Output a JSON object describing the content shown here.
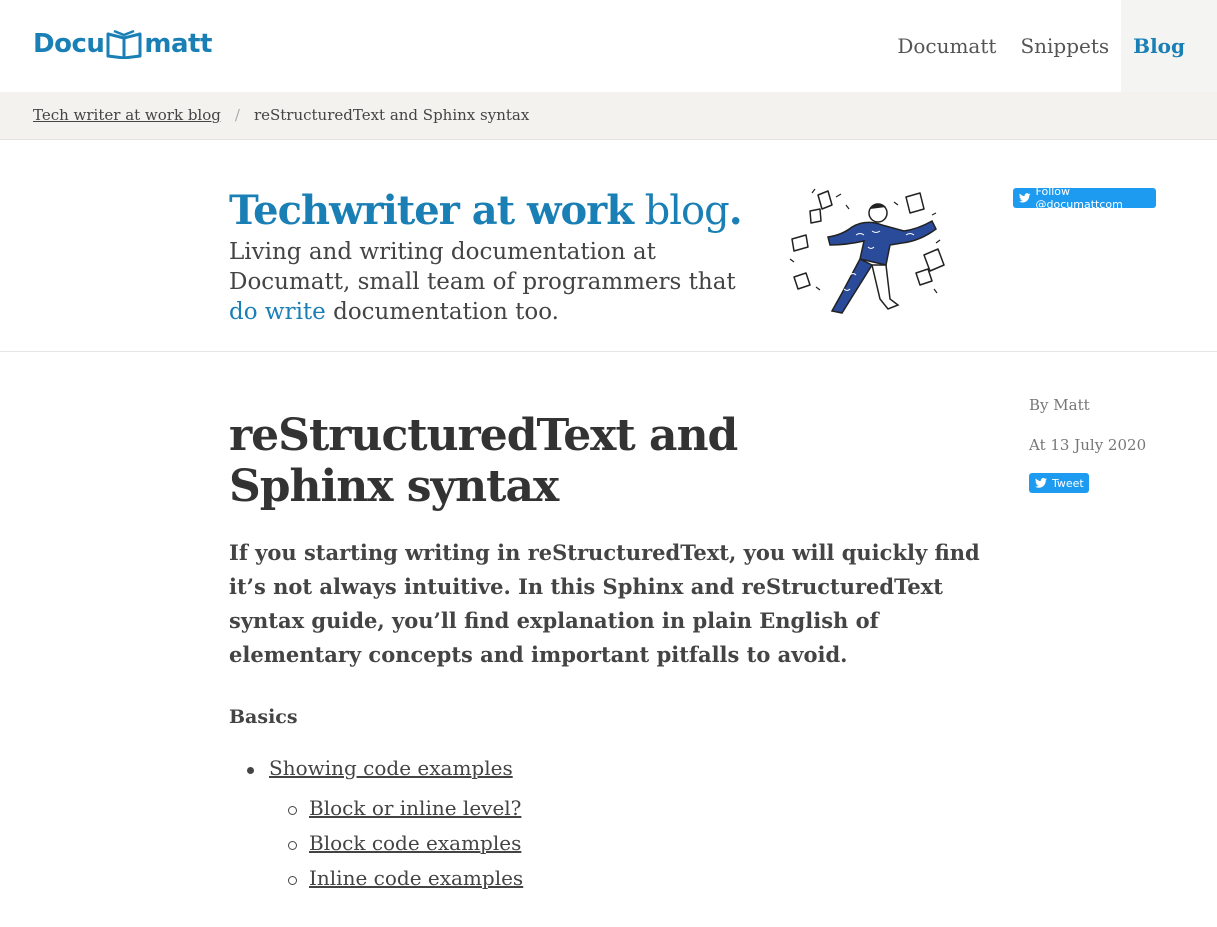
{
  "header": {
    "logo_left": "Docu",
    "logo_right": "matt",
    "nav": [
      "Documatt",
      "Snippets",
      "Blog"
    ],
    "active_nav": "Blog"
  },
  "breadcrumb": {
    "parent": "Tech writer at work blog",
    "separator": "/",
    "current": "reStructuredText and Sphinx syntax"
  },
  "hero": {
    "title_strong": "Techwriter at work",
    "title_light": "blog",
    "title_dot": ".",
    "subtitle_before": "Living and writing documentation at Documatt, small team of programmers that ",
    "subtitle_link": "do write",
    "subtitle_after": " documentation too.",
    "follow_label": "Follow @documattcom"
  },
  "article": {
    "title": "reStructuredText and Sphinx syntax",
    "author": "By Matt",
    "date": "At 13 July 2020",
    "tweet_label": "Tweet",
    "lead": "If you starting writing in reStructuredText, you will quickly find it’s not always intuitive. In this Sphinx and reStructuredText syntax guide, you’ll find explanation in plain English of elementary concepts and important pitfalls to avoid.",
    "section": "Basics",
    "toc": {
      "item": "Showing code examples",
      "subitems": [
        "Block or inline level?",
        "Block code examples",
        "Inline code examples"
      ]
    }
  },
  "colors": {
    "accent": "#1a7fb5",
    "twitter": "#1d9bf0",
    "breadcrumb_bg": "#f3f2ef"
  }
}
